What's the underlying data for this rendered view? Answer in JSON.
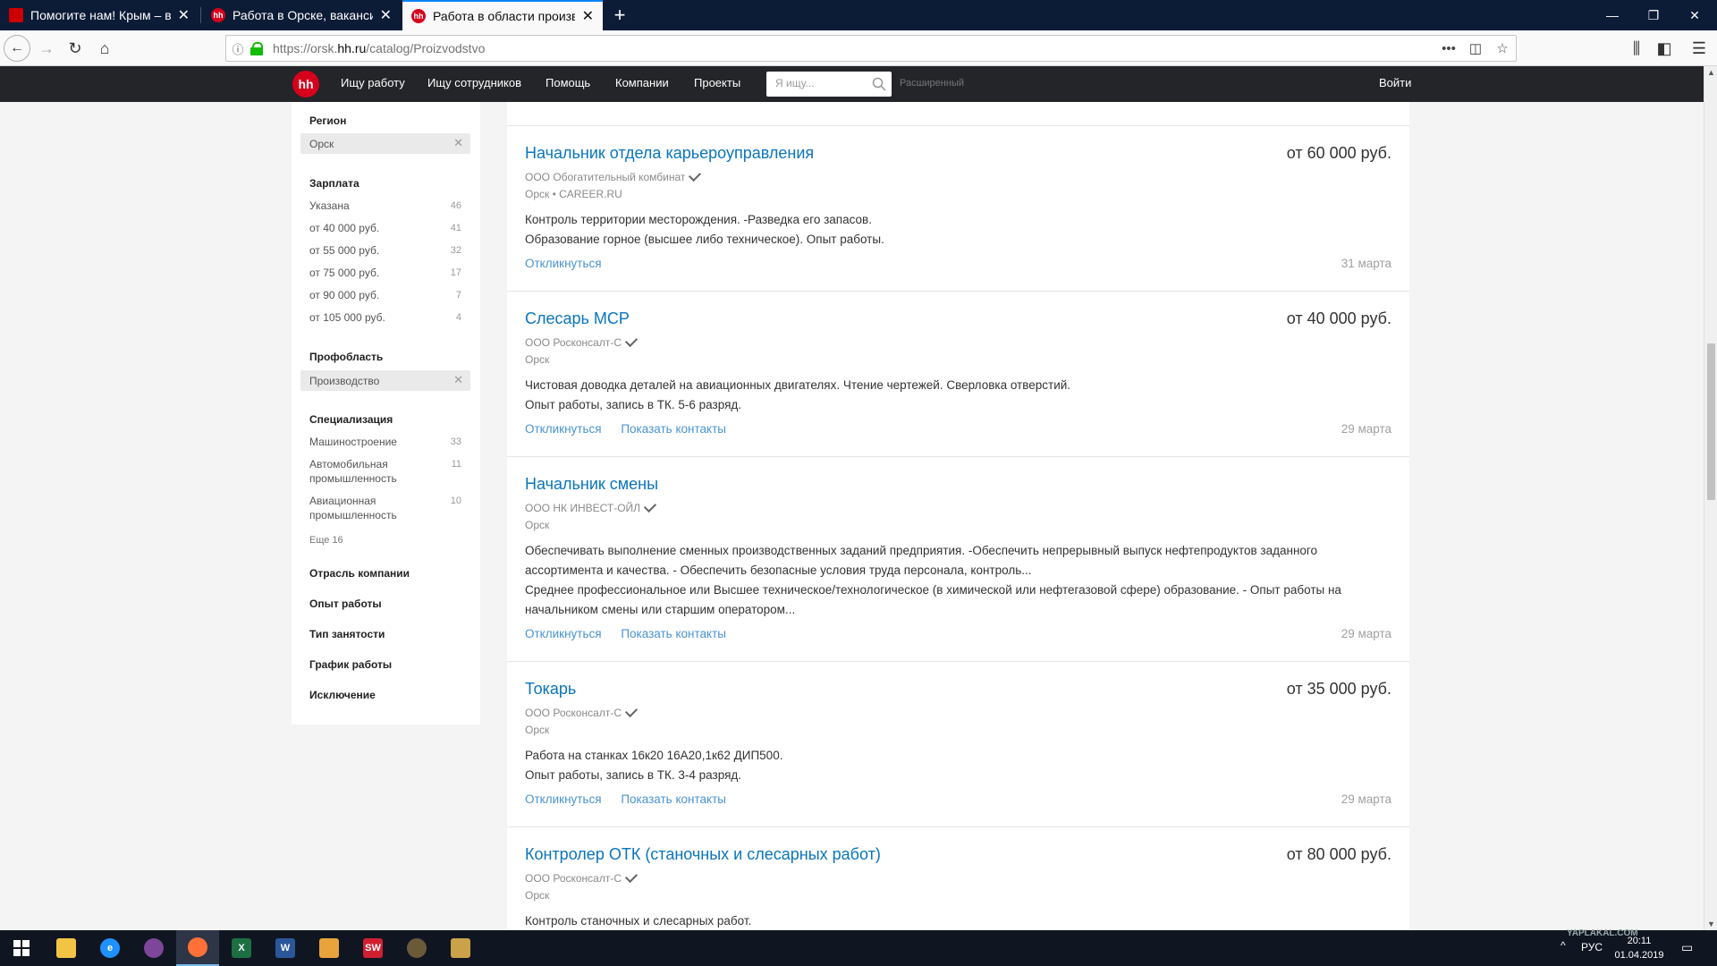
{
  "browser": {
    "tabs": [
      {
        "title": "Помогите нам! Крым – ваш, а",
        "favicon": "pikabu"
      },
      {
        "title": "Работа в Орске, вакансии Ор",
        "favicon": "hh"
      },
      {
        "title": "Работа в области производст",
        "favicon": "hh",
        "active": true
      }
    ],
    "url_prefix": "https://orsk.",
    "url_domain": "hh.ru",
    "url_path": "/catalog/Proizvodstvo"
  },
  "header": {
    "logo": "hh",
    "nav": [
      "Ищу работу",
      "Ищу сотрудников",
      "Помощь",
      "Компании",
      "Проекты"
    ],
    "search_placeholder": "Я ищу...",
    "advanced": "Расширенный",
    "login": "Войти"
  },
  "sidebar": {
    "region_title": "Регион",
    "region_chip": "Орск",
    "salary_title": "Зарплата",
    "salary_items": [
      {
        "label": "Указана",
        "count": "46"
      },
      {
        "label": "от 40 000 руб.",
        "count": "41"
      },
      {
        "label": "от 55 000 руб.",
        "count": "32"
      },
      {
        "label": "от 75 000 руб.",
        "count": "17"
      },
      {
        "label": "от 90 000 руб.",
        "count": "7"
      },
      {
        "label": "от 105 000 руб.",
        "count": "4"
      }
    ],
    "profarea_title": "Профобласть",
    "profarea_chip": "Производство",
    "spec_title": "Специализация",
    "spec_items": [
      {
        "label": "Машиностроение",
        "count": "33"
      },
      {
        "label": "Автомобильная промышленность",
        "count": "11"
      },
      {
        "label": "Авиационная промышленность",
        "count": "10"
      }
    ],
    "spec_more": "Еще 16",
    "sections": [
      "Отрасль компании",
      "Опыт работы",
      "Тип занятости",
      "График работы",
      "Исключение"
    ]
  },
  "vacancies": [
    {
      "title": "Начальник отдела карьероуправления",
      "salary": "от 60 000 руб.",
      "company": "ООО Обогатительный комбинат",
      "meta": "Орск  •  CAREER.RU",
      "desc1": "Контроль территории месторождения. -Разведка его запасов.",
      "desc2": "Образование горное (высшее либо техническое). Опыт работы.",
      "respond": "Откликнуться",
      "contacts": "",
      "date": "31 марта"
    },
    {
      "title": "Слесарь МСР",
      "salary": "от 40 000 руб.",
      "company": "ООО Росконсалт-С",
      "meta": "Орск",
      "desc1": "Чистовая доводка деталей на авиационных двигателях. Чтение чертежей. Сверловка отверстий.",
      "desc2": "Опыт работы, запись в ТК. 5-6 разряд.",
      "respond": "Откликнуться",
      "contacts": "Показать контакты",
      "date": "29 марта"
    },
    {
      "title": "Начальник смены",
      "salary": "",
      "company": "ООО НК ИНВЕСТ-ОЙЛ",
      "meta": "Орск",
      "desc1": "Обеспечивать выполнение сменных производственных заданий предприятия. -Обеспечить непрерывный выпуск нефтепродуктов заданного ассортимента и качества. - Обеспечить безопасные условия труда персонала, контроль...",
      "desc2": "Среднее профессиональное или Высшее техническое/технологическое (в химической или нефтегазовой сфере) образование. - Опыт работы на начальником смены или старшим оператором...",
      "respond": "Откликнуться",
      "contacts": "Показать контакты",
      "date": "29 марта"
    },
    {
      "title": "Токарь",
      "salary": "от 35 000 руб.",
      "company": "ООО Росконсалт-С",
      "meta": "Орск",
      "desc1": "Работа на станках 16к20 16А20,1к62 ДИП500.",
      "desc2": "Опыт работы, запись в ТК. 3-4 разряд.",
      "respond": "Откликнуться",
      "contacts": "Показать контакты",
      "date": "29 марта"
    },
    {
      "title": "Контролер ОТК (станочных и слесарных работ)",
      "salary": "от 80 000 руб.",
      "company": "ООО Росконсалт-С",
      "meta": "Орск",
      "desc1": "Контроль станочных и слесарных работ.",
      "desc2": "",
      "respond": "",
      "contacts": "",
      "date": ""
    }
  ],
  "taskbar": {
    "apps": [
      "start",
      "explorer",
      "internet-explorer",
      "tor-browser",
      "firefox",
      "excel",
      "word",
      "paint",
      "solidworks",
      "app-8",
      "app-9"
    ],
    "lang": "РУС",
    "time": "20:11",
    "date": "01.04.2019",
    "watermark": "YAPLAKAL.COM"
  },
  "colors": {
    "brand_red": "#d6001c",
    "header_bg": "#232529",
    "link_blue": "#0a75bd",
    "tab_bar": "#0c1b36"
  }
}
